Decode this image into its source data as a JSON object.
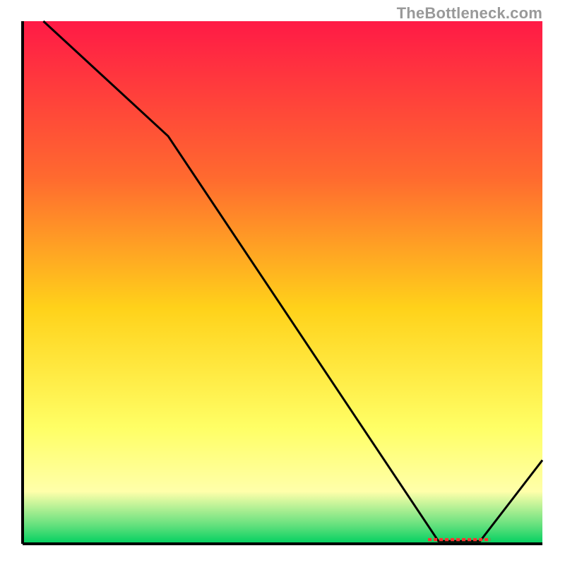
{
  "watermark": "TheBottleneck.com",
  "chart_data": {
    "type": "line",
    "title": "",
    "xlabel": "",
    "ylabel": "",
    "xlim": [
      0,
      100
    ],
    "ylim": [
      0,
      100
    ],
    "grid": false,
    "legend": false,
    "annotations": [],
    "background_gradient_stops": [
      {
        "offset": 0.0,
        "color": "#ff1a46"
      },
      {
        "offset": 0.3,
        "color": "#ff6a2f"
      },
      {
        "offset": 0.55,
        "color": "#ffd21a"
      },
      {
        "offset": 0.78,
        "color": "#ffff66"
      },
      {
        "offset": 0.9,
        "color": "#ffffaa"
      },
      {
        "offset": 0.965,
        "color": "#62e07d"
      },
      {
        "offset": 1.0,
        "color": "#00d060"
      }
    ],
    "series": [
      {
        "name": "curve",
        "color": "#000000",
        "x": [
          4,
          28,
          80,
          88,
          100
        ],
        "y": [
          100,
          78,
          0.5,
          0.5,
          16
        ]
      }
    ],
    "marker_band": {
      "color": "#ff3030",
      "x_start": 78,
      "x_end": 90,
      "y": 0.8,
      "thickness_pct": 0.6
    },
    "axes": {
      "draw_box_sides": [
        "left",
        "bottom"
      ],
      "ticks": []
    }
  }
}
